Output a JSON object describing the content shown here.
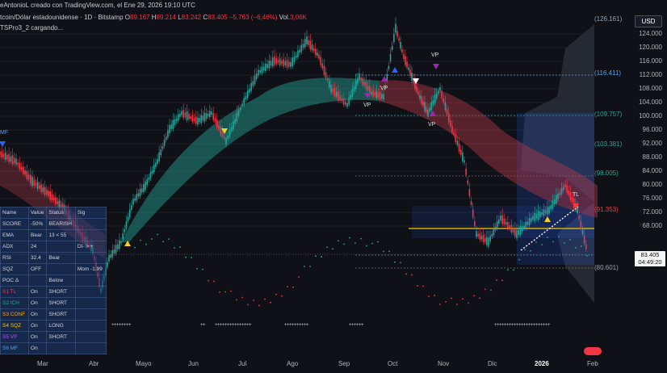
{
  "header": {
    "line1": "eAntonioL creado con TradingView.com, el Ene 29, 2026 19:10 UTC",
    "symbol": "tcoin/Dólar estadounidense · 1D · Bitstamp",
    "o_label": "O",
    "o_val": "89.167",
    "h_label": "H",
    "h_val": "89.214",
    "l_label": "L",
    "l_val": "83.242",
    "c_label": "C",
    "c_val": "83.405",
    "change": "−5.763 (−6,46%)",
    "vol_label": "Vol.",
    "vol_val": "3,06K",
    "indicator": "TSPro3_2 cargando..."
  },
  "currency": "USD",
  "price": {
    "last": "83.405",
    "countdown": "04:49:20"
  },
  "y_axis": [
    "124.000",
    "120.000",
    "116.000",
    "112.000",
    "108.000",
    "104.000",
    "100.000",
    "96.000",
    "92.000",
    "88.000",
    "84.000",
    "80.000",
    "76.000",
    "72.000",
    "68.000"
  ],
  "levels": [
    {
      "text": "(126.161)",
      "color": "#9aa0ab"
    },
    {
      "text": "(116.411)",
      "color": "#5aa0e6"
    },
    {
      "text": "(109.757)",
      "color": "#26a69a"
    },
    {
      "text": "(103.381)",
      "color": "#26a69a"
    },
    {
      "text": "(98.005)",
      "color": "#26a69a"
    },
    {
      "text": "(91.353)",
      "color": "#f23645"
    },
    {
      "text": "(80.601)",
      "color": "#9aa0ab"
    }
  ],
  "x_axis": [
    "Mar",
    "Abr",
    "Mayo",
    "Jun",
    "Jul",
    "Ago",
    "Sep",
    "Oct",
    "Nov",
    "Dic",
    "2026",
    "Feb"
  ],
  "annotations": {
    "vp": "VP",
    "tl": "TL",
    "mf": "MF"
  },
  "table": {
    "headers": [
      "Name",
      "Value",
      "Status",
      "Sig"
    ],
    "rows": [
      [
        "SCORE",
        "-50%",
        "BEARISH",
        ""
      ],
      [
        "EMA",
        "Bear",
        "13 < 55",
        ""
      ],
      [
        "ADX",
        "24",
        "",
        "DI- > +"
      ],
      [
        "RSI",
        "32.4",
        "Bear",
        ""
      ],
      [
        "SQZ",
        "OFF",
        "",
        "Mom -1.99"
      ],
      [
        "POC Δ",
        "",
        "Below",
        ""
      ],
      [
        "S1 TL",
        "On",
        "SHORT",
        ""
      ],
      [
        "S2 ICH",
        "On",
        "SHORT",
        ""
      ],
      [
        "S3 CONF",
        "On",
        "SHORT",
        ""
      ],
      [
        "S4 SQZ",
        "On",
        "LONG",
        ""
      ],
      [
        "S5 VP",
        "On",
        "SHORT",
        ""
      ],
      [
        "S6 MF",
        "On",
        "",
        ""
      ]
    ]
  }
}
